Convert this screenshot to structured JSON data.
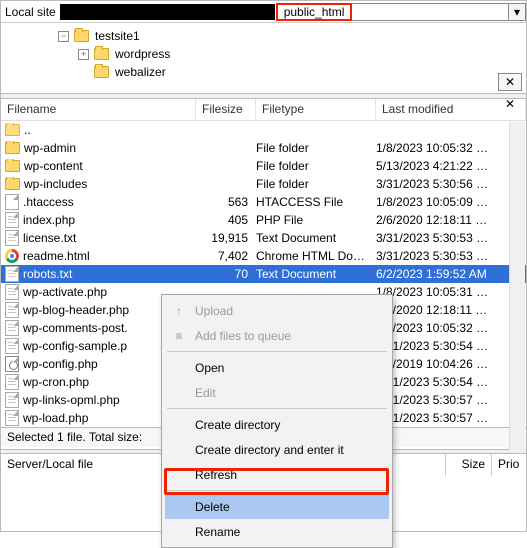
{
  "top": {
    "label": "Local site",
    "path_highlight": "public_html"
  },
  "tree": {
    "items": [
      {
        "name": "testsite1",
        "toggle": "−",
        "indent": 0
      },
      {
        "name": "wordpress",
        "toggle": "+",
        "indent": 20
      },
      {
        "name": "webalizer",
        "toggle": "",
        "indent": 20
      }
    ]
  },
  "columns": {
    "filename": "Filename",
    "filesize": "Filesize",
    "filetype": "Filetype",
    "lastmod": "Last modified"
  },
  "files": [
    {
      "name": "..",
      "size": "",
      "type": "",
      "mod": "",
      "icon": "up"
    },
    {
      "name": "wp-admin",
      "size": "",
      "type": "File folder",
      "mod": "1/8/2023 10:05:32 …",
      "icon": "folder"
    },
    {
      "name": "wp-content",
      "size": "",
      "type": "File folder",
      "mod": "5/13/2023 4:21:22 …",
      "icon": "folder"
    },
    {
      "name": "wp-includes",
      "size": "",
      "type": "File folder",
      "mod": "3/31/2023 5:30:56 …",
      "icon": "folder"
    },
    {
      "name": ".htaccess",
      "size": "563",
      "type": "HTACCESS File",
      "mod": "1/8/2023 10:05:09 …",
      "icon": "file"
    },
    {
      "name": "index.php",
      "size": "405",
      "type": "PHP File",
      "mod": "2/6/2020 12:18:11 …",
      "icon": "php"
    },
    {
      "name": "license.txt",
      "size": "19,915",
      "type": "Text Document",
      "mod": "3/31/2023 5:30:53 …",
      "icon": "txt"
    },
    {
      "name": "readme.html",
      "size": "7,402",
      "type": "Chrome HTML Do…",
      "mod": "3/31/2023 5:30:53 …",
      "icon": "chrome"
    },
    {
      "name": "robots.txt",
      "size": "70",
      "type": "Text Document",
      "mod": "6/2/2023 1:59:52 AM",
      "icon": "txt",
      "selected": true
    },
    {
      "name": "wp-activate.php",
      "size": "",
      "type": "",
      "mod": "1/8/2023 10:05:31 …",
      "icon": "php"
    },
    {
      "name": "wp-blog-header.php",
      "size": "",
      "type": "",
      "mod": "2/6/2020 12:18:11 …",
      "icon": "php"
    },
    {
      "name": "wp-comments-post.",
      "size": "",
      "type": "",
      "mod": "1/8/2023 10:05:32 …",
      "icon": "php"
    },
    {
      "name": "wp-config-sample.p",
      "size": "",
      "type": "",
      "mod": "3/31/2023 5:30:54 …",
      "icon": "php"
    },
    {
      "name": "wp-config.php",
      "size": "",
      "type": "",
      "mod": "4/1/2019 10:04:26 …",
      "icon": "cfg"
    },
    {
      "name": "wp-cron.php",
      "size": "",
      "type": "",
      "mod": "3/31/2023 5:30:54 …",
      "icon": "php"
    },
    {
      "name": "wp-links-opml.php",
      "size": "",
      "type": "",
      "mod": "3/31/2023 5:30:57 …",
      "icon": "php"
    },
    {
      "name": "wp-load.php",
      "size": "",
      "type": "",
      "mod": "3/31/2023 5:30:57 …",
      "icon": "php"
    }
  ],
  "status": {
    "line1": "Selected 1 file. Total size:",
    "server_label": "Server/Local file",
    "size_label": "Size",
    "prio_label": "Prio"
  },
  "context_menu": {
    "upload": "Upload",
    "add_queue": "Add files to queue",
    "open": "Open",
    "edit": "Edit",
    "create_dir": "Create directory",
    "create_dir_enter": "Create directory and enter it",
    "refresh": "Refresh",
    "delete": "Delete",
    "rename": "Rename"
  }
}
